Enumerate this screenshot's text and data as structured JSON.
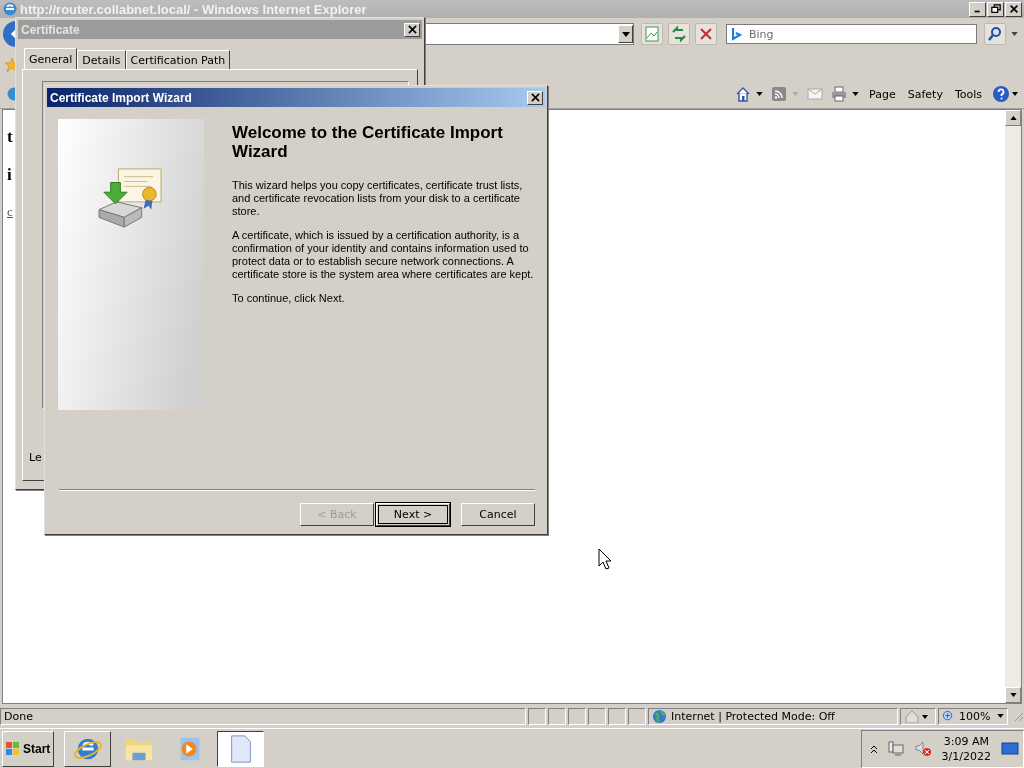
{
  "browser": {
    "title": "http://router.collabnet.local/ - Windows Internet Explorer",
    "search": {
      "placeholder": "Bing"
    },
    "commands": [
      "Page",
      "Safety",
      "Tools"
    ],
    "page_fragments": [
      {
        "text": "t",
        "kind": "heading"
      },
      {
        "text": "i",
        "kind": "heading"
      },
      {
        "text": "c",
        "kind": "link"
      }
    ],
    "status": "Done",
    "zone": "Internet | Protected Mode: Off",
    "zoom": "100%"
  },
  "certificate_dialog": {
    "title": "Certificate",
    "tabs": [
      {
        "label": "General",
        "selected": true
      },
      {
        "label": "Details",
        "selected": false
      },
      {
        "label": "Certification Path",
        "selected": false
      }
    ],
    "fragment": "Le"
  },
  "wizard": {
    "title": "Certificate Import Wizard",
    "heading": "Welcome to the Certificate Import Wizard",
    "paragraphs": [
      "This wizard helps you copy certificates, certificate trust lists, and certificate revocation lists from your disk to a certificate store.",
      "A certificate, which is issued by a certification authority, is a confirmation of your identity and contains information used to protect data or to establish secure network connections. A certificate store is the system area where certificates are kept.",
      "To continue, click Next."
    ],
    "buttons": [
      {
        "label": "< Back",
        "disabled": true,
        "default": false
      },
      {
        "label": "Next >",
        "disabled": false,
        "default": true
      },
      {
        "label": "Cancel",
        "disabled": false,
        "default": false
      }
    ]
  },
  "taskbar": {
    "start": "Start",
    "time": "3:09 AM",
    "date": "3/1/2022"
  }
}
